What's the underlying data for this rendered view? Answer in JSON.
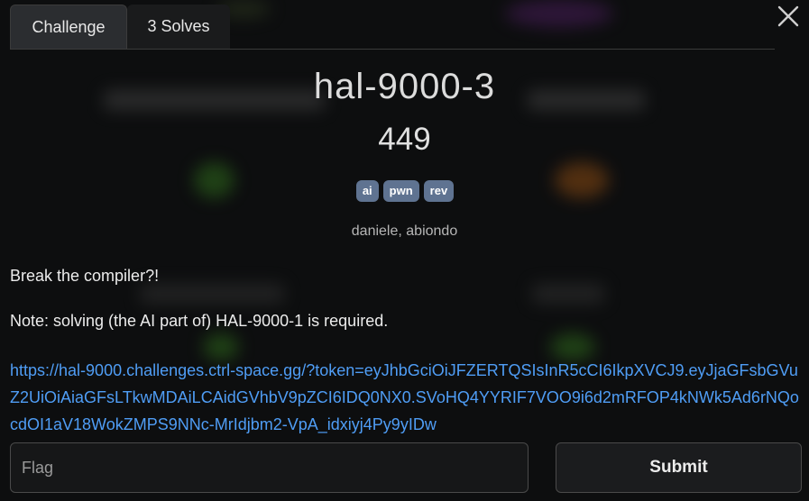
{
  "tabs": [
    {
      "label": "Challenge",
      "active": true
    },
    {
      "label": "3 Solves",
      "active": false
    }
  ],
  "challenge": {
    "title": "hal-9000-3",
    "points": "449",
    "tags": [
      "ai",
      "pwn",
      "rev"
    ],
    "authors": "daniele, abiondo",
    "description": [
      "Break the compiler?!",
      "Note: solving (the AI part of) HAL-9000-1 is required."
    ],
    "link": "https://hal-9000.challenges.ctrl-space.gg/?token=eyJhbGciOiJFZERTQSIsInR5cCI6IkpXVCJ9.eyJjaGFsbGVuZ2UiOiAiaGFsLTkwMDAiLCAidGVhbV9pZCI6IDQ0NX0.SVoHQ4YYRIF7VOO9i6d2mRFOP4kNWk5Ad6rNQocdOI1aV18WokZMPS9NNc-MrIdjbm2-VpA_idxiyj4Py9yIDw"
  },
  "form": {
    "flag_placeholder": "Flag",
    "submit_label": "Submit"
  },
  "colors": {
    "tag_bg": "#5f7391",
    "link": "#4f9df5",
    "background": "#0d0e0f"
  },
  "icons": {
    "close": "close-icon"
  }
}
